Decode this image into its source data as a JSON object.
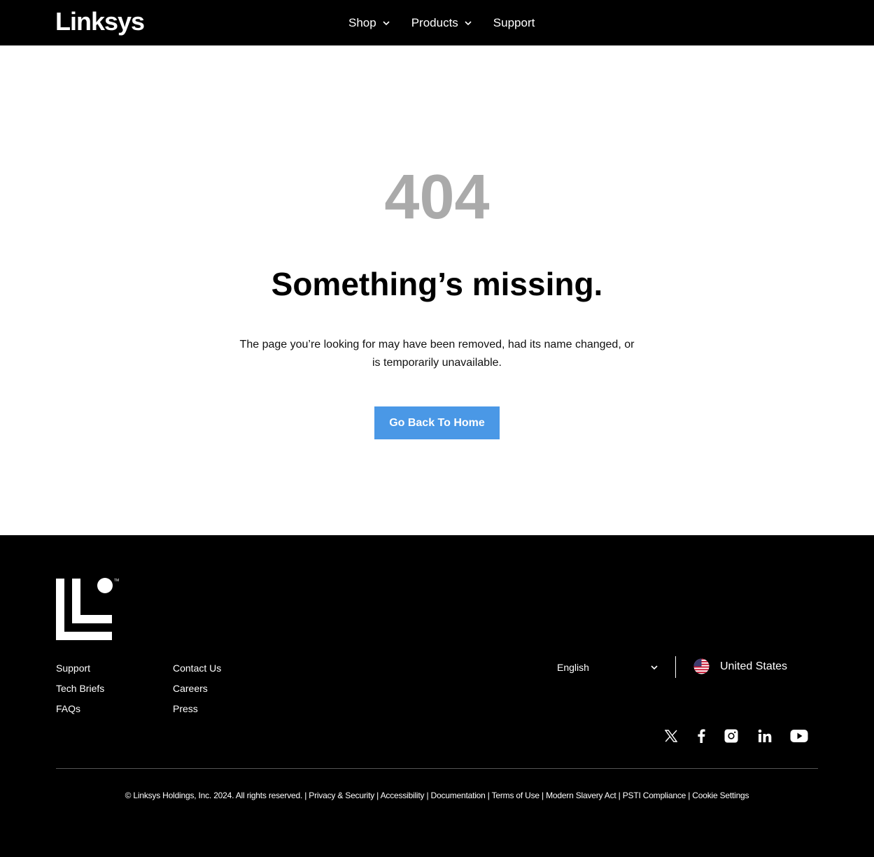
{
  "header": {
    "logo": "Linksys",
    "nav": [
      {
        "label": "Shop",
        "has_dropdown": true
      },
      {
        "label": "Products",
        "has_dropdown": true
      },
      {
        "label": "Support",
        "has_dropdown": false
      }
    ]
  },
  "main": {
    "error_code": "404",
    "headline": "Something’s missing.",
    "description": "The page you’re looking for may have been removed, had its name changed, or is temporarily unavailable.",
    "button_label": "Go Back To Home",
    "button_color": "#4a98e6",
    "error_code_color": "#aaaaaa"
  },
  "footer": {
    "col1": [
      "Support",
      "Tech Briefs",
      "FAQs"
    ],
    "col2": [
      "Contact Us",
      "Careers",
      "Press"
    ],
    "language": "English",
    "country": "United States",
    "social_icons": [
      "x-icon",
      "facebook-icon",
      "instagram-icon",
      "linkedin-icon",
      "youtube-icon"
    ],
    "copyright": "© Linksys Holdings, Inc. 2024. All rights reserved.",
    "legal_links": [
      "Privacy & Security",
      "Accessibility",
      "Documentation",
      "Terms of Use",
      "Modern Slavery Act",
      "PSTI Compliance",
      "Cookie Settings"
    ]
  }
}
